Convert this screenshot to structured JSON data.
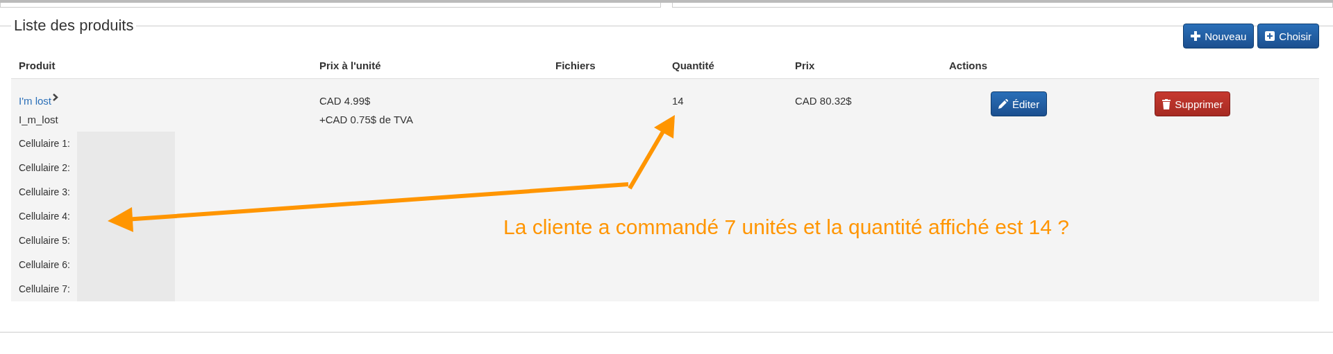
{
  "panel": {
    "title": "Liste des produits"
  },
  "toolbar": [
    {
      "label": "Nouveau"
    },
    {
      "label": "Choisir"
    }
  ],
  "table": {
    "columns": [
      "Produit",
      "Prix à l'unité",
      "Fichiers",
      "Quantité",
      "Prix",
      "Actions"
    ],
    "rows": [
      {
        "product": "I'm lost",
        "code": "I_m_lost",
        "unit_price": "CAD 4.99$",
        "tax": "+CAD 0.75$ de TVA",
        "quantity": "14",
        "price": "CAD 80.32$",
        "fields": [
          "Cellulaire 1:",
          "Cellulaire 2:",
          "Cellulaire 3:",
          "Cellulaire 4:",
          "Cellulaire 5:",
          "Cellulaire 6:",
          "Cellulaire 7:"
        ],
        "actions": [
          {
            "label": "Éditer",
            "kind": "primary"
          },
          {
            "label": "Supprimer",
            "kind": "danger"
          }
        ]
      }
    ]
  },
  "annotation": {
    "text": "La cliente a commandé 7 unités et la quantité affiché est 14 ?"
  }
}
